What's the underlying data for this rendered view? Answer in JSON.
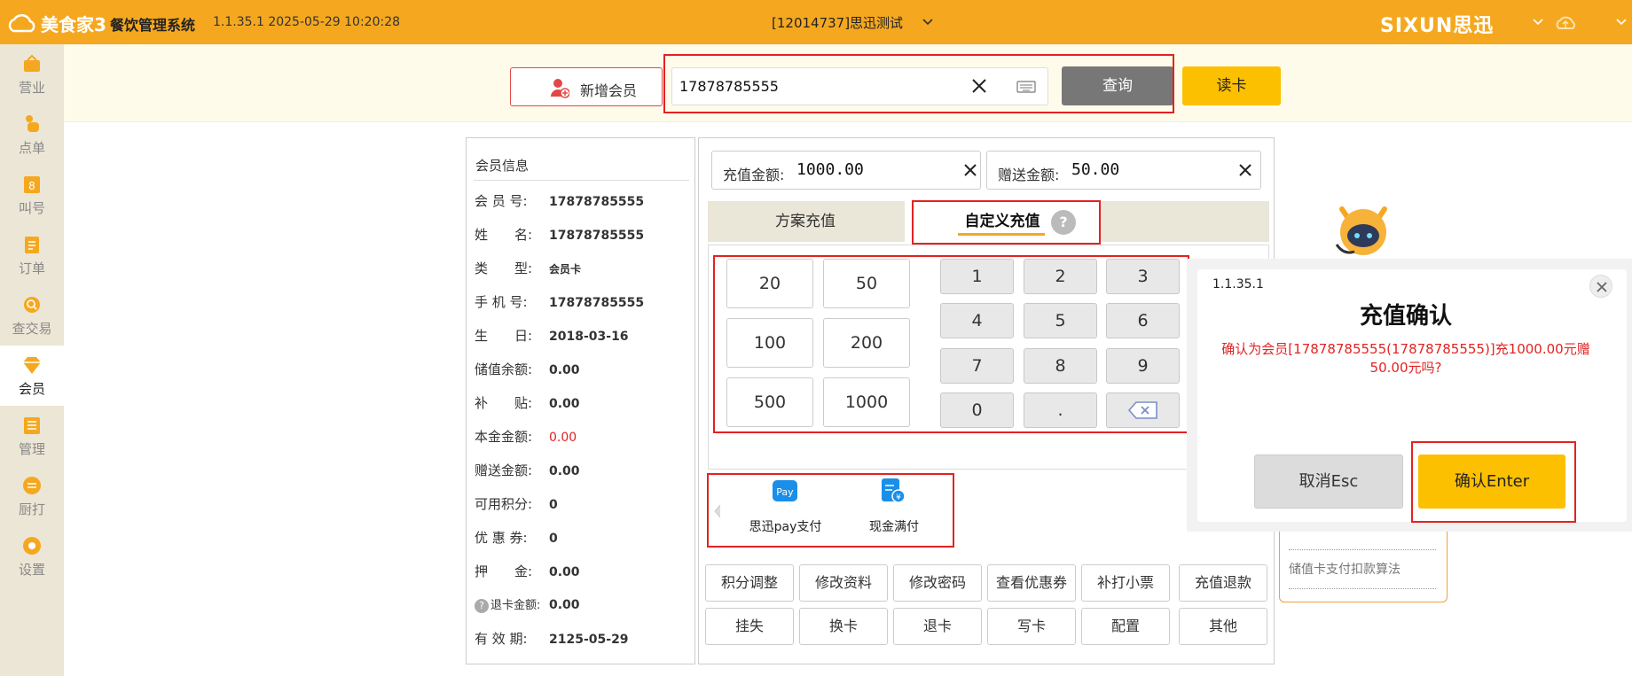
{
  "topbar": {
    "brand": "美食家3",
    "system_name": "餐饮管理系统",
    "version_time": "1.1.35.1 2025-05-29 10:20:28",
    "store": "[12014737]思迅测试",
    "vendor": "SIXUN思迅"
  },
  "sidebar": {
    "items": [
      {
        "label": "营业",
        "icon": "business-icon"
      },
      {
        "label": "点单",
        "icon": "order-hand-icon"
      },
      {
        "label": "叫号",
        "icon": "call-number-icon"
      },
      {
        "label": "订单",
        "icon": "list-icon"
      },
      {
        "label": "查交易",
        "icon": "search-icon"
      },
      {
        "label": "会员",
        "icon": "diamond-icon",
        "active": true
      },
      {
        "label": "管理",
        "icon": "manage-icon"
      },
      {
        "label": "厨打",
        "icon": "kitchen-print-icon"
      },
      {
        "label": "设置",
        "icon": "gear-icon"
      }
    ]
  },
  "search": {
    "add_member_label": "新增会员",
    "value": "17878785555",
    "query_label": "查询",
    "read_card_label": "读卡"
  },
  "member": {
    "title": "会员信息",
    "rows": [
      {
        "key": "会 员 号:",
        "value": "17878785555"
      },
      {
        "key": "姓　　名:",
        "value": "17878785555"
      },
      {
        "key": "类　　型:",
        "value": "会员卡"
      },
      {
        "key": "手 机 号:",
        "value": "17878785555"
      },
      {
        "key": "生　　日:",
        "value": "2018-03-16"
      },
      {
        "key": "储值余额:",
        "value": "0.00"
      },
      {
        "key": "补　　贴:",
        "value": "0.00"
      },
      {
        "key": "本金金额:",
        "value": "0.00"
      },
      {
        "key": "赠送金额:",
        "value": "0.00"
      },
      {
        "key": "可用积分:",
        "value": "0"
      },
      {
        "key": "优 惠 券:",
        "value": "0"
      },
      {
        "key": "押　　金:",
        "value": "0.00"
      },
      {
        "key": "退卡金额:",
        "value": "0.00"
      },
      {
        "key": "有 效 期:",
        "value": "2125-05-29"
      }
    ]
  },
  "recharge": {
    "amount_label": "充值金额:",
    "amount_value": "1000.00",
    "gift_label": "赠送金额:",
    "gift_value": "50.00",
    "tab_plan": "方案充值",
    "tab_custom": "自定义充值",
    "help": "?",
    "quick_amounts": [
      "20",
      "50",
      "100",
      "200",
      "500",
      "1000"
    ],
    "keypad": [
      "1",
      "2",
      "3",
      "4",
      "5",
      "6",
      "7",
      "8",
      "9",
      "0",
      "."
    ],
    "pay_methods": [
      {
        "label": "思迅pay支付",
        "icon": "pay-icon"
      },
      {
        "label": "现金满付",
        "icon": "cash-icon"
      }
    ],
    "actions_row1": [
      "积分调整",
      "修改资料",
      "修改密码",
      "查看优惠券",
      "补打小票",
      "充值退款"
    ],
    "actions_row2": [
      "挂失",
      "换卡",
      "退卡",
      "写卡",
      "配置",
      "其他"
    ]
  },
  "dialog": {
    "version": "1.1.35.1",
    "title": "充值确认",
    "message": "确认为会员[17878785555(17878785555)]充1000.00元赠50.00元吗?",
    "cancel_label": "取消Esc",
    "ok_label": "确认Enter"
  },
  "tip": {
    "text": "储值卡支付扣款算法"
  },
  "colors": {
    "accent": "#f5a81f",
    "confirm": "#fcc000",
    "highlight": "#e32222"
  }
}
